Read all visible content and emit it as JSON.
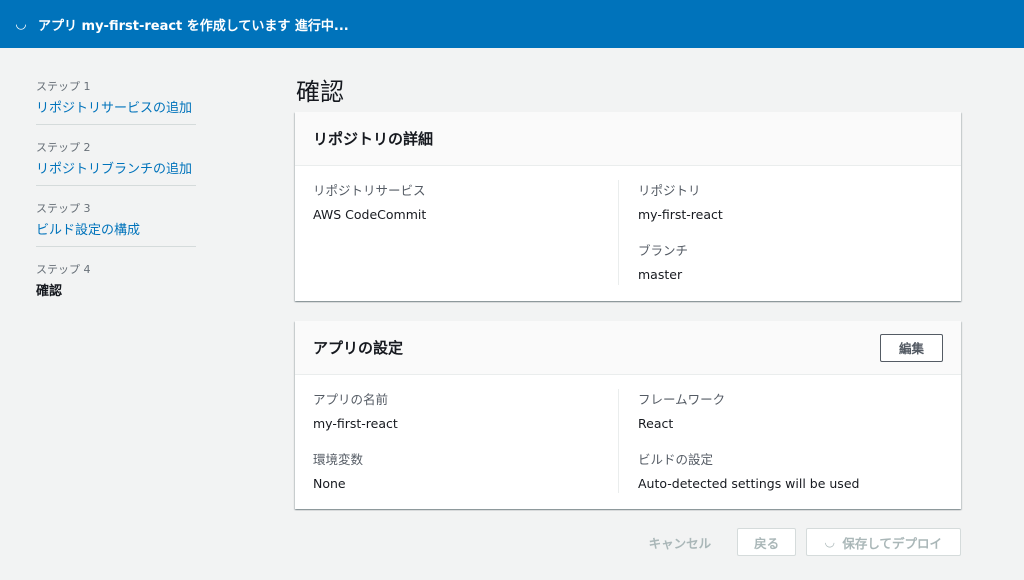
{
  "flash": {
    "spinner_icon": "spinner-icon",
    "message": "アプリ my-first-react を作成しています 進行中..."
  },
  "wizard": {
    "steps": [
      {
        "step_label": "ステップ 1",
        "title": "リポジトリサービスの追加"
      },
      {
        "step_label": "ステップ 2",
        "title": "リポジトリブランチの追加"
      },
      {
        "step_label": "ステップ 3",
        "title": "ビルド設定の構成"
      },
      {
        "step_label": "ステップ 4",
        "title": "確認"
      }
    ]
  },
  "page": {
    "title": "確認"
  },
  "repo_panel": {
    "title": "リポジトリの詳細",
    "service_key": "リポジトリサービス",
    "service_value": "AWS CodeCommit",
    "repo_key": "リポジトリ",
    "repo_value": "my-first-react",
    "branch_key": "ブランチ",
    "branch_value": "master"
  },
  "app_panel": {
    "title": "アプリの設定",
    "edit_label": "編集",
    "name_key": "アプリの名前",
    "name_value": "my-first-react",
    "env_key": "環境変数",
    "env_value": "None",
    "framework_key": "フレームワーク",
    "framework_value": "React",
    "build_key": "ビルドの設定",
    "build_value": "Auto-detected settings will be used"
  },
  "actions": {
    "cancel_label": "キャンセル",
    "back_label": "戻る",
    "deploy_label": "保存してデプロイ",
    "deploy_icon": "spinner-icon"
  },
  "colors": {
    "flash_bg": "#0073bb",
    "link": "#0073bb",
    "page_bg": "#f2f3f3"
  }
}
